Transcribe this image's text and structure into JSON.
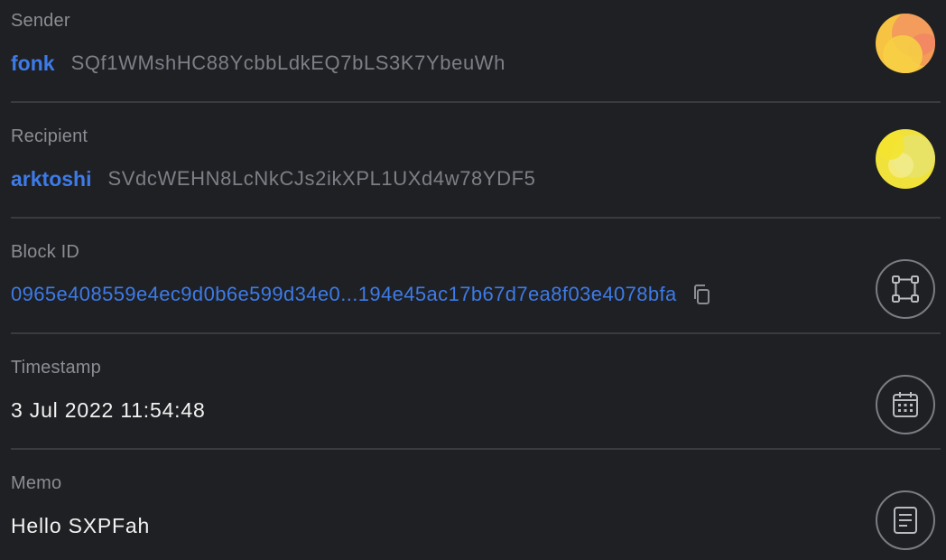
{
  "sender": {
    "label": "Sender",
    "name": "fonk",
    "address": "SQf1WMshHC88YcbbLdkEQ7bLS3K7YbeuWh",
    "avatar_icon": "sender-avatar-icon",
    "avatar_colors": [
      "#f6b93b",
      "#f28b5c",
      "#f7d046"
    ]
  },
  "recipient": {
    "label": "Recipient",
    "name": "arktoshi",
    "address": "SVdcWEHN8LcNkCJs2ikXPL1UXd4w78YDF5",
    "avatar_icon": "recipient-avatar-icon",
    "avatar_colors": [
      "#f3e13a",
      "#e8e86a",
      "#f5ef8f"
    ]
  },
  "block": {
    "label": "Block ID",
    "id": "0965e408559e4ec9d0b6e599d34e0...194e45ac17b67d7ea8f03e4078bfa",
    "copy_icon": "copy-icon",
    "icon": "block-icon"
  },
  "timestamp": {
    "label": "Timestamp",
    "value": "3 Jul 2022 11:54:48",
    "icon": "calendar-icon"
  },
  "memo": {
    "label": "Memo",
    "value": "Hello SXPFah",
    "icon": "document-icon"
  },
  "colors": {
    "background": "#1f2023",
    "link": "#3d7be8",
    "label": "#8a8d93",
    "divider": "#3a3b3f"
  }
}
